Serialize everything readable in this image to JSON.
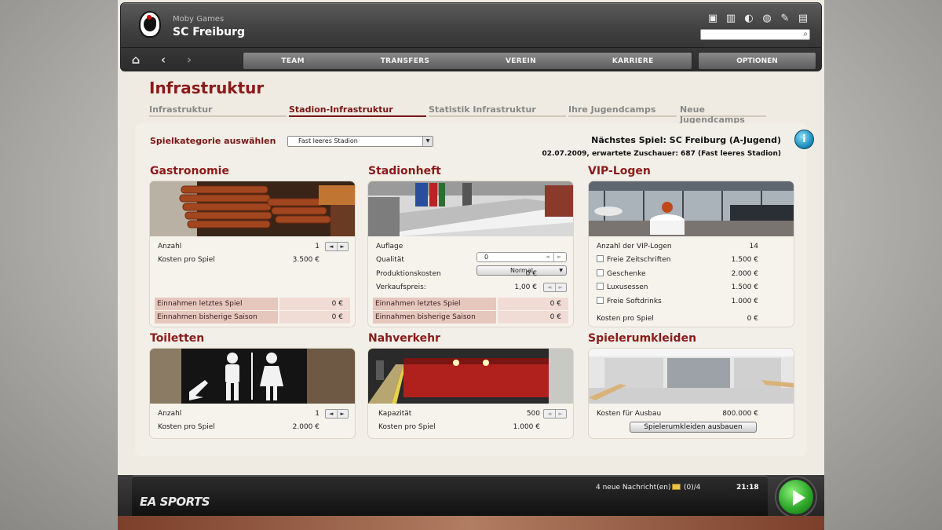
{
  "header": {
    "subtitle": "Moby Games",
    "club_name": "SC Freiburg",
    "nav": [
      "TEAM",
      "TRANSFERS",
      "VEREIN",
      "KARRIERE"
    ],
    "options_label": "OPTIONEN"
  },
  "page": {
    "title": "Infrastruktur",
    "subtabs": [
      "Infrastruktur",
      "Stadion-Infrastruktur",
      "Statistik Infrastruktur",
      "Ihre Jugendcamps",
      "Neue Jugendcamps"
    ],
    "active_subtab": "Stadion-Infrastruktur",
    "category_label": "Spielkategorie auswählen",
    "category_value": "Fast leeres Stadion",
    "next_game": "Nächstes Spiel: SC Freiburg (A-Jugend)",
    "next_game_details": "02.07.2009, erwartete Zuschauer: 687 (Fast leeres Stadion)"
  },
  "gastronomie": {
    "title": "Gastronomie",
    "anzahl_label": "Anzahl",
    "anzahl_value": "1",
    "kosten_label": "Kosten pro Spiel",
    "kosten_value": "3.500 €",
    "einnahmen_letztes_label": "Einnahmen letztes Spiel",
    "einnahmen_letztes_value": "0 €",
    "einnahmen_saison_label": "Einnahmen bisherige Saison",
    "einnahmen_saison_value": "0 €"
  },
  "stadionheft": {
    "title": "Stadionheft",
    "auflage_label": "Auflage",
    "auflage_value": "0",
    "qualitaet_label": "Qualität",
    "qualitaet_value": "Normal",
    "produktionskosten_label": "Produktionskosten",
    "produktionskosten_value": "0 €",
    "verkaufspreis_label": "Verkaufspreis:",
    "verkaufspreis_value": "1,00 €",
    "einnahmen_letztes_label": "Einnahmen letztes Spiel",
    "einnahmen_letztes_value": "0 €",
    "einnahmen_saison_label": "Einnahmen bisherige Saison",
    "einnahmen_saison_value": "0 €"
  },
  "vip": {
    "title": "VIP-Logen",
    "anzahl_label": "Anzahl der VIP-Logen",
    "anzahl_value": "14",
    "options": [
      {
        "label": "Freie Zeitschriften",
        "value": "1.500 €"
      },
      {
        "label": "Geschenke",
        "value": "2.000 €"
      },
      {
        "label": "Luxusessen",
        "value": "1.500 €"
      },
      {
        "label": "Freie Softdrinks",
        "value": "1.000 €"
      }
    ],
    "kosten_label": "Kosten pro Spiel",
    "kosten_value": "0 €"
  },
  "toiletten": {
    "title": "Toiletten",
    "anzahl_label": "Anzahl",
    "anzahl_value": "1",
    "kosten_label": "Kosten pro Spiel",
    "kosten_value": "2.000 €"
  },
  "nahverkehr": {
    "title": "Nahverkehr",
    "kapazitaet_label": "Kapazität",
    "kapazitaet_value": "500",
    "kosten_label": "Kosten pro Spiel",
    "kosten_value": "1.000 €"
  },
  "umkleiden": {
    "title": "Spielerumkleiden",
    "kosten_label": "Kosten für Ausbau",
    "kosten_value": "800.000 €",
    "button_label": "Spielerumkleiden ausbauen"
  },
  "footer": {
    "brand": "EA SPORTS",
    "messages": "4 neue Nachricht(en)",
    "mail_count": "(0)/4",
    "time": "21:18"
  },
  "colors": {
    "accent": "#8b1a1a",
    "income_bg": "#e6c7bd",
    "play": "#2ea82a",
    "info": "#2092c0"
  }
}
